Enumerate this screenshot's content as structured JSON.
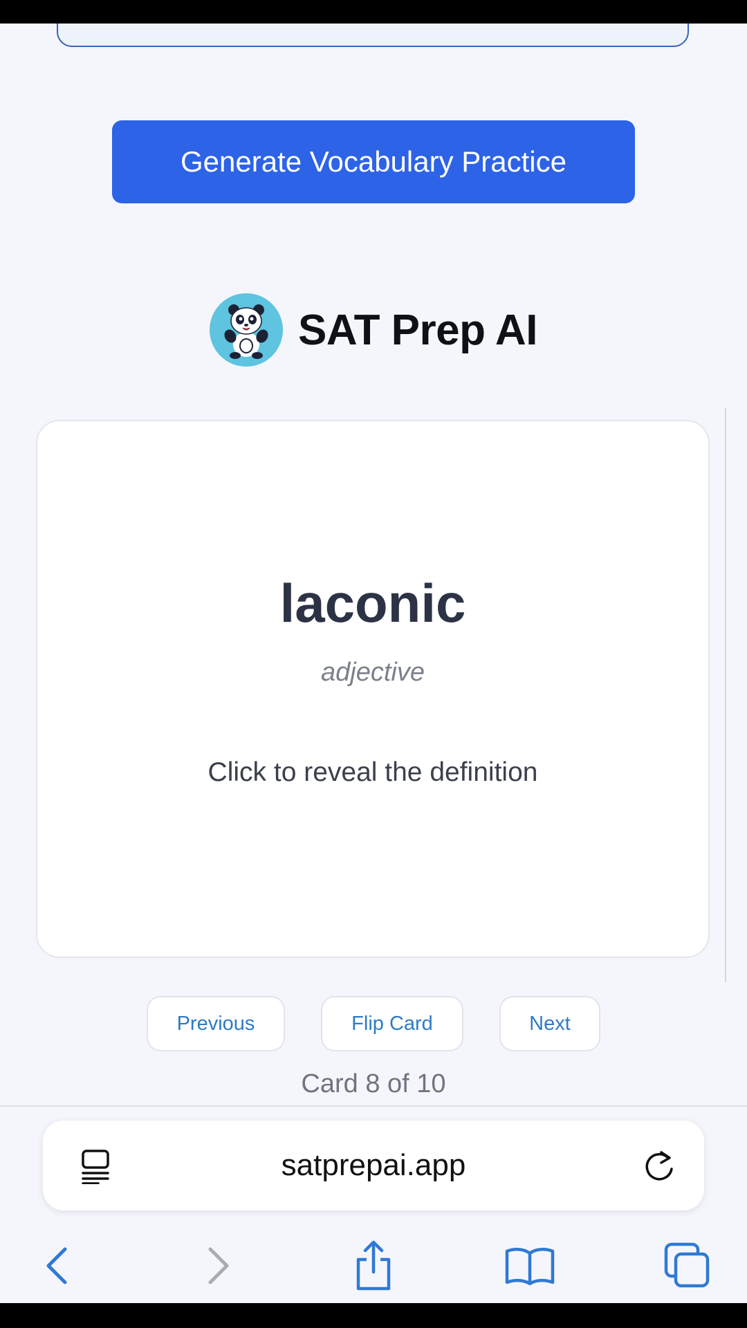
{
  "generate_button": {
    "label": "Generate Vocabulary Practice"
  },
  "brand": {
    "title": "SAT Prep AI",
    "logo_icon": "panda-logo-icon"
  },
  "flashcard": {
    "word": "laconic",
    "part_of_speech": "adjective",
    "hint": "Click to reveal the definition"
  },
  "controls": {
    "previous_label": "Previous",
    "flip_label": "Flip Card",
    "next_label": "Next"
  },
  "counter": {
    "text": "Card 8 of 10",
    "current": 8,
    "total": 10
  },
  "browser": {
    "url": "satprepai.app",
    "icons": [
      "reader-icon",
      "reload-icon",
      "back-icon",
      "forward-icon",
      "share-icon",
      "bookmarks-icon",
      "tabs-icon"
    ]
  },
  "colors": {
    "accent": "#2d63e6",
    "link": "#2f7ac5",
    "ios_blue": "#2f7ad3",
    "logo_bg": "#5ec4df"
  }
}
